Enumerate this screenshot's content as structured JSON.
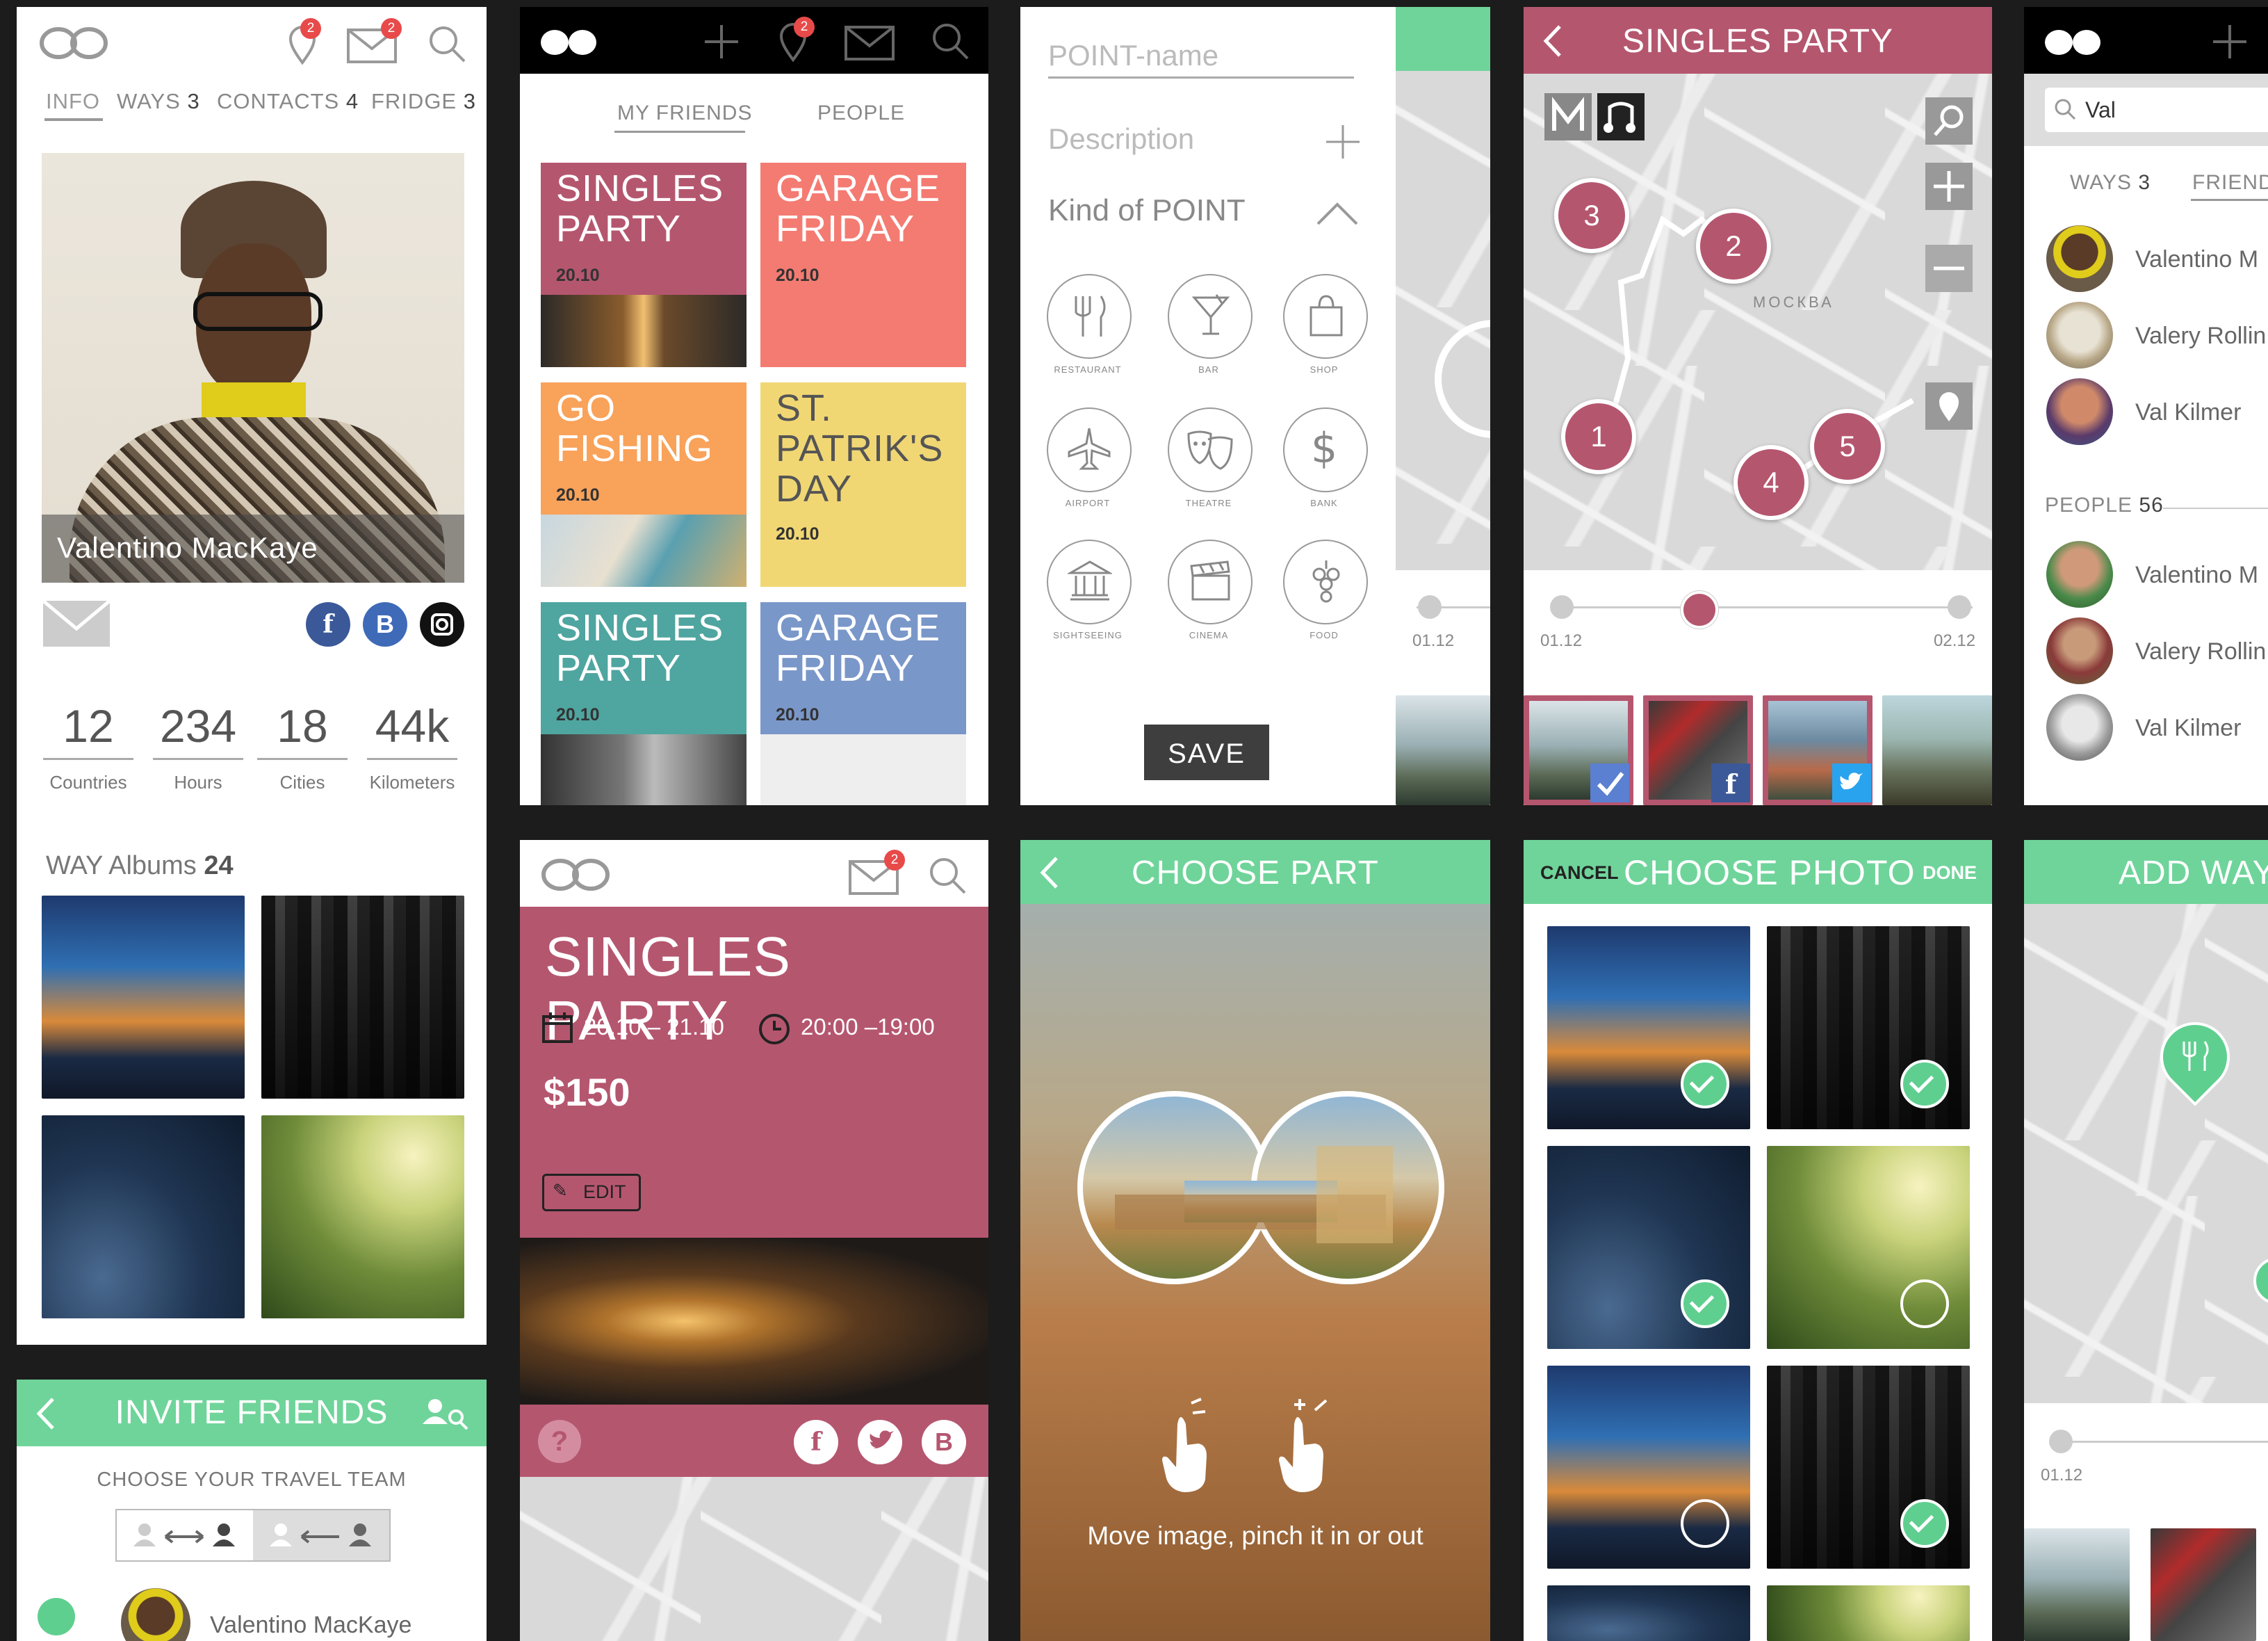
{
  "profile": {
    "tabs": [
      {
        "label": "INFO"
      },
      {
        "label": "WAYS",
        "count": "3"
      },
      {
        "label": "CONTACTS",
        "count": "4"
      },
      {
        "label": "FRIDGE",
        "count": "3"
      }
    ],
    "badge_location": "2",
    "badge_mail": "2",
    "name": "Valentino MacKaye",
    "social_f": "f",
    "social_b": "B",
    "stats": [
      {
        "value": "12",
        "label": "Countries"
      },
      {
        "value": "234",
        "label": "Hours"
      },
      {
        "value": "18",
        "label": "Cities"
      },
      {
        "value": "44k",
        "label": "Kilometers"
      }
    ],
    "albums_label": "WAY Albums",
    "albums_count": "24"
  },
  "invite": {
    "title": "INVITE FRIENDS",
    "subtitle": "CHOOSE YOUR TRAVEL TEAM",
    "first_friend": "Valentino MacKaye"
  },
  "friends_grid": {
    "tabs": [
      "MY FRIENDS",
      "PEOPLE"
    ],
    "badge": "2",
    "tiles": [
      {
        "title": "SINGLES PARTY",
        "date": "20.10",
        "color": "#b5566f"
      },
      {
        "title": "GARAGE FRIDAY",
        "date": "20.10",
        "color": "#f47b72"
      },
      {
        "title": "GO FISHING",
        "date": "20.10",
        "color": "#f9a25a"
      },
      {
        "title": "ST. PATRIK'S DAY",
        "date": "20.10",
        "color": "#f1d774"
      },
      {
        "title": "SINGLES PARTY",
        "date": "20.10",
        "color": "#4fa5a0"
      },
      {
        "title": "GARAGE FRIDAY",
        "date": "20.10",
        "color": "#7a97c9"
      }
    ]
  },
  "event": {
    "badge": "2",
    "title": "SINGLES PARTY",
    "dates": "20.10 – 21.10",
    "times": "20:00 –19:00",
    "price": "$150",
    "edit": "EDIT",
    "help": "?",
    "social_f": "f",
    "social_b": "B"
  },
  "point": {
    "name_placeholder": "POINT-name",
    "description_placeholder": "Description",
    "kind_label": "Kind of POINT",
    "categories": [
      {
        "label": "RESTAURANT",
        "icon": "restaurant-icon"
      },
      {
        "label": "BAR",
        "icon": "bar-icon"
      },
      {
        "label": "SHOP",
        "icon": "shop-icon"
      },
      {
        "label": "AIRPORT",
        "icon": "airport-icon"
      },
      {
        "label": "THEATRE",
        "icon": "theatre-icon"
      },
      {
        "label": "BANK",
        "icon": "bank-icon"
      },
      {
        "label": "SIGHTSEEING",
        "icon": "sightseeing-icon"
      },
      {
        "label": "CINEMA",
        "icon": "cinema-icon"
      },
      {
        "label": "FOOD",
        "icon": "food-icon"
      }
    ],
    "save": "SAVE",
    "timeline_start": "01.12"
  },
  "choose_part": {
    "title": "CHOOSE PART",
    "hint": "Move image, pinch it in or out"
  },
  "singles_map": {
    "title": "SINGLES PARTY",
    "city_label": "МОСКВА",
    "pins": [
      "3",
      "2",
      "1",
      "4",
      "5"
    ],
    "timeline_start": "01.12",
    "timeline_end": "02.12",
    "slider_position": 0.33,
    "social_f": "f"
  },
  "choose_photo": {
    "cancel": "CANCEL",
    "title": "CHOOSE PHOTO",
    "done": "DONE",
    "selected": [
      true,
      true,
      true,
      false,
      false,
      true
    ]
  },
  "search": {
    "query": "Val",
    "tabs": [
      {
        "label": "WAYS",
        "count": "3"
      },
      {
        "label": "FRIEND"
      }
    ],
    "friends": [
      "Valentino M",
      "Valery Rollin",
      "Val Kilmer"
    ],
    "people_label": "PEOPLE",
    "people_count": "56",
    "people": [
      "Valentino M",
      "Valery Rollin",
      "Val Kilmer"
    ]
  },
  "add_way": {
    "title": "ADD WAY",
    "timeline_start": "01.12"
  },
  "colors": {
    "green": "#6fd49a",
    "pink": "#b5566f",
    "badge": "#e84a4a",
    "facebook": "#3b5998",
    "b_social": "#3f6ab8"
  }
}
